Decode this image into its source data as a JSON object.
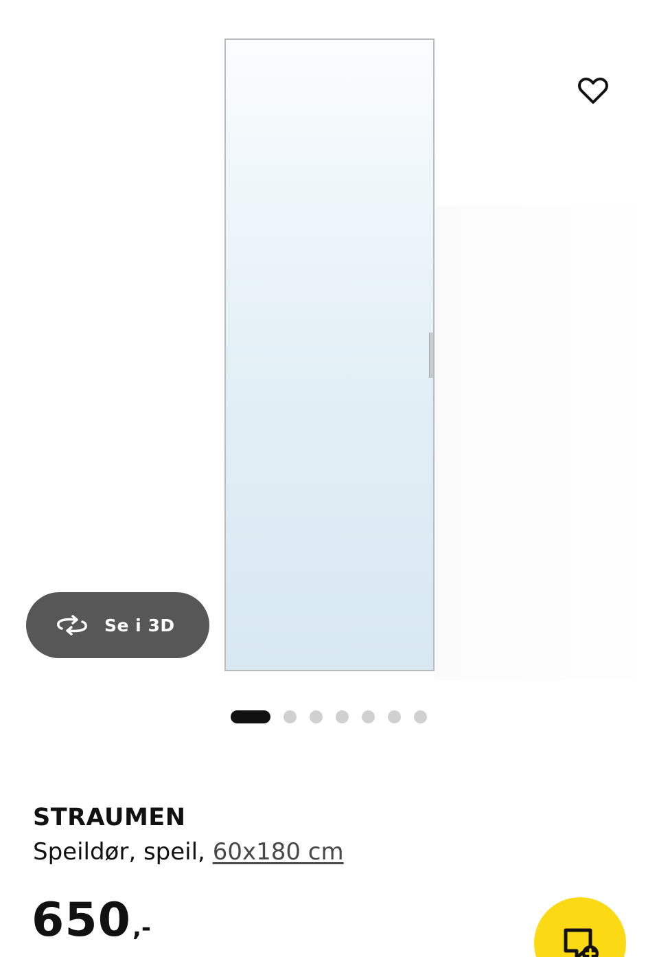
{
  "media": {
    "favorite_icon": "heart-outline-icon",
    "view_3d": {
      "icon": "rotate-3d-icon",
      "label": "Se i 3D"
    },
    "carousel": {
      "total": 7,
      "active_index": 0
    }
  },
  "product": {
    "name": "STRAUMEN",
    "description": "Speildør, speil,",
    "size_link": "60x180 cm"
  },
  "price": {
    "integer": "650",
    "suffix": ",-"
  },
  "cart_button": {
    "icon": "add-to-bag-icon"
  },
  "colors": {
    "cart_yellow": "#fbd914",
    "pill_gray": "#575757",
    "dot_active": "#111111",
    "dot_inactive": "#d0d0d0"
  }
}
